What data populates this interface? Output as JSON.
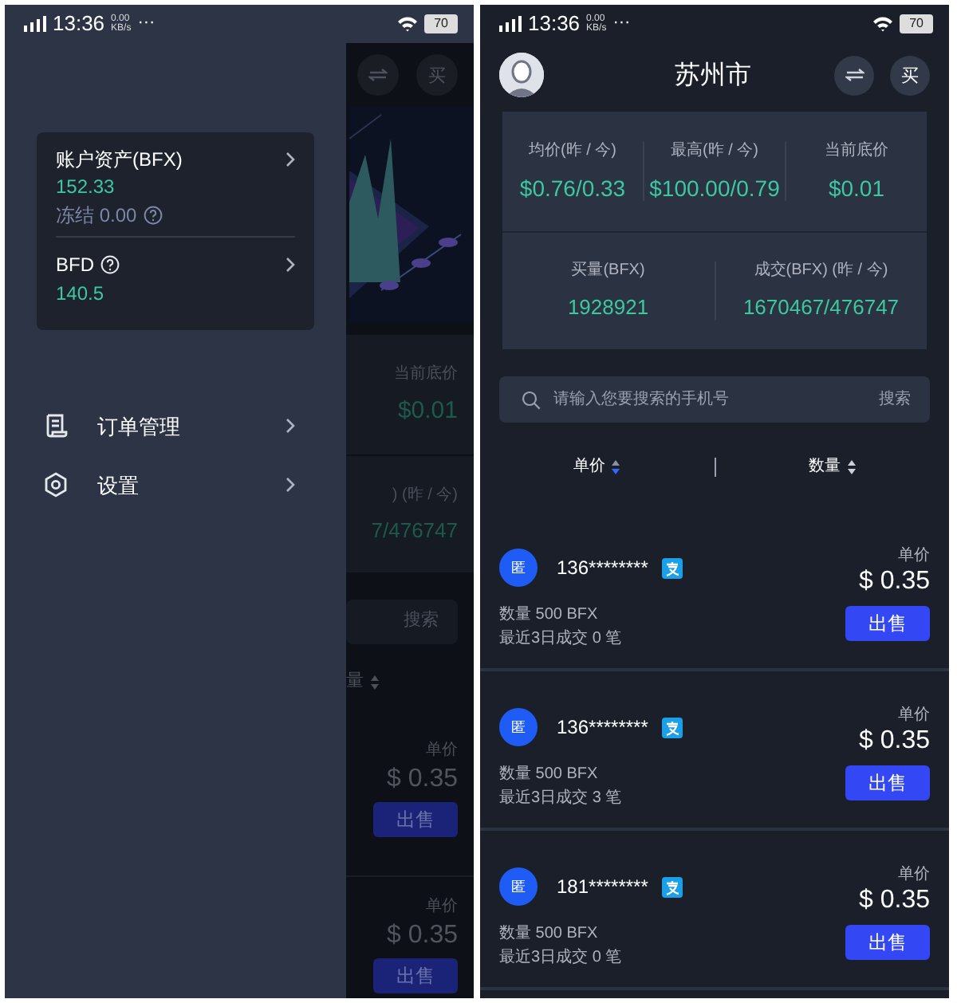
{
  "drawer_screen": {
    "status_bar": {
      "time": "13:36",
      "speed": "0.00",
      "speed_unit": "KB/s",
      "more": "···",
      "battery": "70"
    },
    "drawer": {
      "asset_rows": [
        {
          "label": "账户资产(BFX)",
          "help": false,
          "value": "152.33",
          "frozen": "冻结 0.00"
        },
        {
          "label": "BFD",
          "help": true,
          "value": "140.5"
        }
      ],
      "menu": [
        {
          "kind": "orders",
          "label": "订单管理"
        },
        {
          "kind": "settings",
          "label": "设置"
        }
      ]
    },
    "background": {
      "buy_button": "买",
      "stat_label": "当前底价",
      "stat_value": "$0.01",
      "stat_label_2": ") (昨 / 今)",
      "stat_value_2": "7/476747",
      "search_button": "搜索",
      "sort_label": "量",
      "listings": [
        {
          "price_label": "单价",
          "price": "$ 0.35",
          "action": "出售"
        },
        {
          "price_label": "单价",
          "price": "$ 0.35",
          "action": "出售"
        }
      ]
    }
  },
  "market_screen": {
    "status_bar": {
      "time": "13:36",
      "speed": "0.00",
      "speed_unit": "KB/s",
      "more": "···",
      "battery": "70"
    },
    "header": {
      "title": "苏州市",
      "buy_button": "买"
    },
    "stat_rows": [
      {
        "cells": [
          {
            "label": "均价(昨 / 今)",
            "value": "$0.76/0.33"
          },
          {
            "label": "最高(昨 / 今)",
            "value": "$100.00/0.79"
          },
          {
            "label": "当前底价",
            "value": "$0.01"
          }
        ]
      },
      {
        "cells": [
          {
            "label": "买量(BFX)",
            "value": "1928921"
          },
          {
            "label": "成交(BFX) (昨 / 今)",
            "value": "1670467/476747"
          }
        ]
      }
    ],
    "search": {
      "placeholder": "请输入您要搜索的手机号",
      "button": "搜索"
    },
    "sort_columns": [
      {
        "label": "单价",
        "selected": true
      },
      {
        "label": "数量",
        "selected": false
      }
    ],
    "listings": [
      {
        "badge": "匿",
        "phone": "136********",
        "quantity": "数量 500 BFX",
        "recent": "最近3日成交 0 笔",
        "price_label": "单价",
        "price": "$ 0.35",
        "action": "出售"
      },
      {
        "badge": "匿",
        "phone": "136********",
        "quantity": "数量 500 BFX",
        "recent": "最近3日成交 3 笔",
        "price_label": "单价",
        "price": "$ 0.35",
        "action": "出售"
      },
      {
        "badge": "匿",
        "phone": "181********",
        "quantity": "数量 500 BFX",
        "recent": "最近3日成交 0 笔",
        "price_label": "单价",
        "price": "$ 0.35",
        "action": "出售"
      }
    ]
  }
}
